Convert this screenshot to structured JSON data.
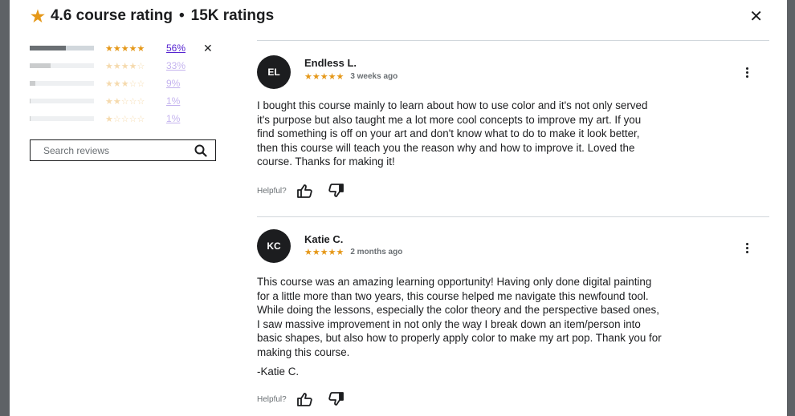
{
  "header": {
    "rating": "4.6 course rating",
    "separator": "•",
    "count": "15K ratings"
  },
  "filters": [
    {
      "stars": 5,
      "percent": "56%",
      "fill": 0.56
    },
    {
      "stars": 4,
      "percent": "33%",
      "fill": 0.33
    },
    {
      "stars": 3,
      "percent": "9%",
      "fill": 0.09
    },
    {
      "stars": 2,
      "percent": "1%",
      "fill": 0.01
    },
    {
      "stars": 1,
      "percent": "1%",
      "fill": 0.01
    }
  ],
  "search": {
    "placeholder": "Search reviews"
  },
  "reviews": [
    {
      "initials": "EL",
      "name": "Endless L.",
      "stars": 5,
      "time": "3 weeks ago",
      "lines": [
        "I bought this course mainly to learn about how to use color and it's not only served",
        "it's purpose but also taught me a lot more cool concepts to improve my art. If you",
        "find something is off on your art and don't know what to do to make it look better,",
        "then this course will teach you the reason why and how to improve it. Loved the",
        "course. Thanks for making it!"
      ],
      "signoff": "",
      "helpful_label": "Helpful?"
    },
    {
      "initials": "KC",
      "name": "Katie C.",
      "stars": 5,
      "time": "2 months ago",
      "lines": [
        "This course was an amazing learning opportunity! Having only done digital painting",
        "for a little more than two years, this course helped me navigate this newfound tool.",
        "While doing the lessons, especially the color theory and the perspective based ones,",
        "I saw massive improvement in not only the way I break down an item/person into",
        "basic shapes, but also how to properly apply color to make my art pop. Thank you for",
        "making this course."
      ],
      "signoff": "-Katie C.",
      "helpful_label": "Helpful?"
    }
  ],
  "colors": {
    "star": "#e59819",
    "link": "#5624d0",
    "bar_fill": "#6a6f73",
    "bar_track": "#d1d7dc"
  }
}
